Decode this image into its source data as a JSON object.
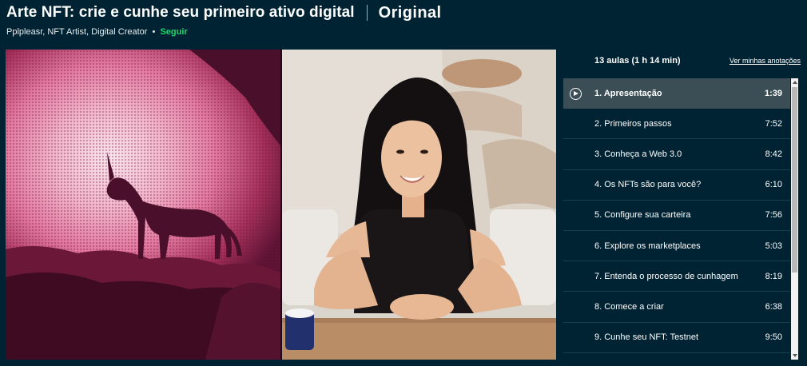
{
  "header": {
    "title": "Arte NFT: crie e cunhe seu primeiro ativo digital",
    "badge": "Original",
    "authors": "Pplpleasr, NFT Artist, Digital Creator",
    "separator": "•",
    "follow_label": "Seguir"
  },
  "panel": {
    "lesson_count": "13 aulas (1 h 14 min)",
    "notes_link": "Ver minhas anotações",
    "lessons": [
      {
        "label": "1. Apresentação",
        "duration": "1:39",
        "active": true
      },
      {
        "label": "2. Primeiros passos",
        "duration": "7:52"
      },
      {
        "label": "3. Conheça a Web 3.0",
        "duration": "8:42"
      },
      {
        "label": "4. Os NFTs são para você?",
        "duration": "6:10"
      },
      {
        "label": "5. Configure sua carteira",
        "duration": "7:56"
      },
      {
        "label": "6. Explore os marketplaces",
        "duration": "5:03"
      },
      {
        "label": "7. Entenda o processo de cunhagem",
        "duration": "8:19"
      },
      {
        "label": "8. Comece a criar",
        "duration": "6:38"
      },
      {
        "label": "9. Cunhe seu NFT: Testnet",
        "duration": "9:50"
      }
    ]
  },
  "colors": {
    "background": "#002333",
    "accent_follow": "#1fd46e",
    "active_row": "#3c4e55"
  }
}
